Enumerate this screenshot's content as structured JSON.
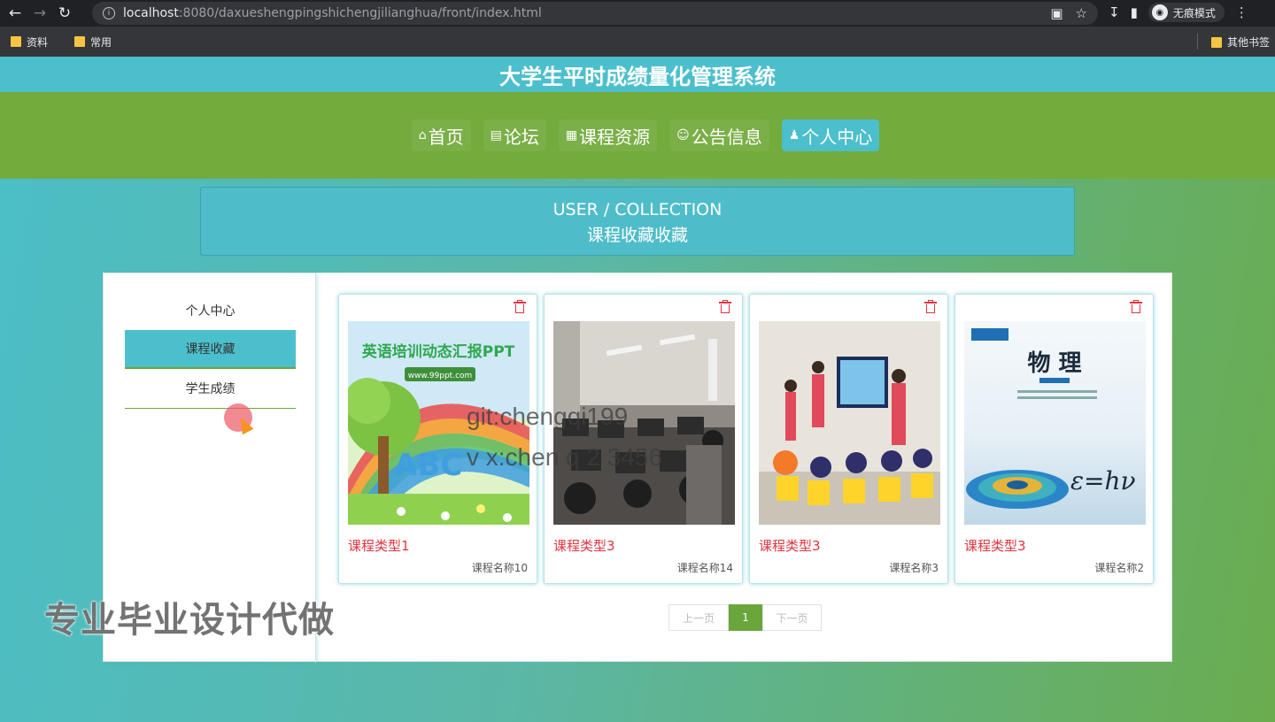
{
  "browser": {
    "url_host": "localhost",
    "url_rest": ":8080/daxueshengpingshichengjilianghua/front/index.html",
    "incognito_label": "无痕模式",
    "bookmarks": [
      "资料",
      "常用"
    ],
    "other_bookmarks": "其他书签"
  },
  "header": {
    "title": "大学生平时成绩量化管理系统"
  },
  "nav": {
    "items": [
      {
        "label": "首页",
        "icon": "home-icon"
      },
      {
        "label": "论坛",
        "icon": "forum-icon"
      },
      {
        "label": "课程资源",
        "icon": "gift-icon"
      },
      {
        "label": "公告信息",
        "icon": "smile-icon"
      },
      {
        "label": "个人中心",
        "icon": "user-icon"
      }
    ],
    "active": "个人中心"
  },
  "breadcrumb": {
    "en": "USER / COLLECTION",
    "cn": "课程收藏收藏"
  },
  "sidebar": {
    "items": [
      {
        "label": "个人中心"
      },
      {
        "label": "课程收藏"
      },
      {
        "label": "学生成绩"
      }
    ],
    "active": "课程收藏"
  },
  "cards": [
    {
      "type": "课程类型1",
      "name": "课程名称10",
      "image": "英语培训动态汇报PPT",
      "image_sub": "www.99ppt.com"
    },
    {
      "type": "课程类型3",
      "name": "课程名称14",
      "image": "computer-lab-photo"
    },
    {
      "type": "课程类型3",
      "name": "课程名称3",
      "image": "classroom-children-photo"
    },
    {
      "type": "课程类型3",
      "name": "课程名称2",
      "image": "物 理",
      "image_formula": "ε=hν"
    }
  ],
  "pagination": {
    "prev": "上一页",
    "current": "1",
    "next": "下一页"
  },
  "overlay": {
    "git": "git:chengqi199",
    "vx": "v x:chen  q  2  3456",
    "ad": "专业毕业设计代做"
  },
  "colors": {
    "primary": "#4cbfcc",
    "nav_green": "#73ab3c",
    "accent_red": "#e2343f"
  }
}
